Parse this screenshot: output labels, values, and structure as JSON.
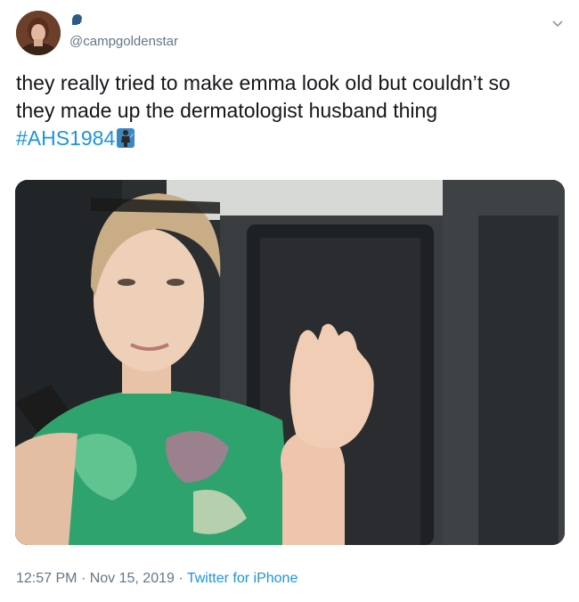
{
  "user": {
    "handle": "@campgoldenstar",
    "avatar_icon": "profile-photo",
    "name_icon": "speaking-head-icon"
  },
  "tweet": {
    "text_line1": "they really tried to make emma look old but couldn’t so",
    "text_line2": "they made up the dermatologist husband thing",
    "hashtag": "#AHS1984",
    "hashtag_emoji": "knife-slasher-emoji"
  },
  "media": {
    "type": "video-still",
    "description_icon": "car-interior-photo"
  },
  "meta": {
    "time": "12:57 PM",
    "separator": "·",
    "date": "Nov 15, 2019",
    "source": "Twitter for iPhone"
  },
  "colors": {
    "link": "#1b95e0",
    "secondary_text": "#657786",
    "primary_text": "#14171a"
  }
}
